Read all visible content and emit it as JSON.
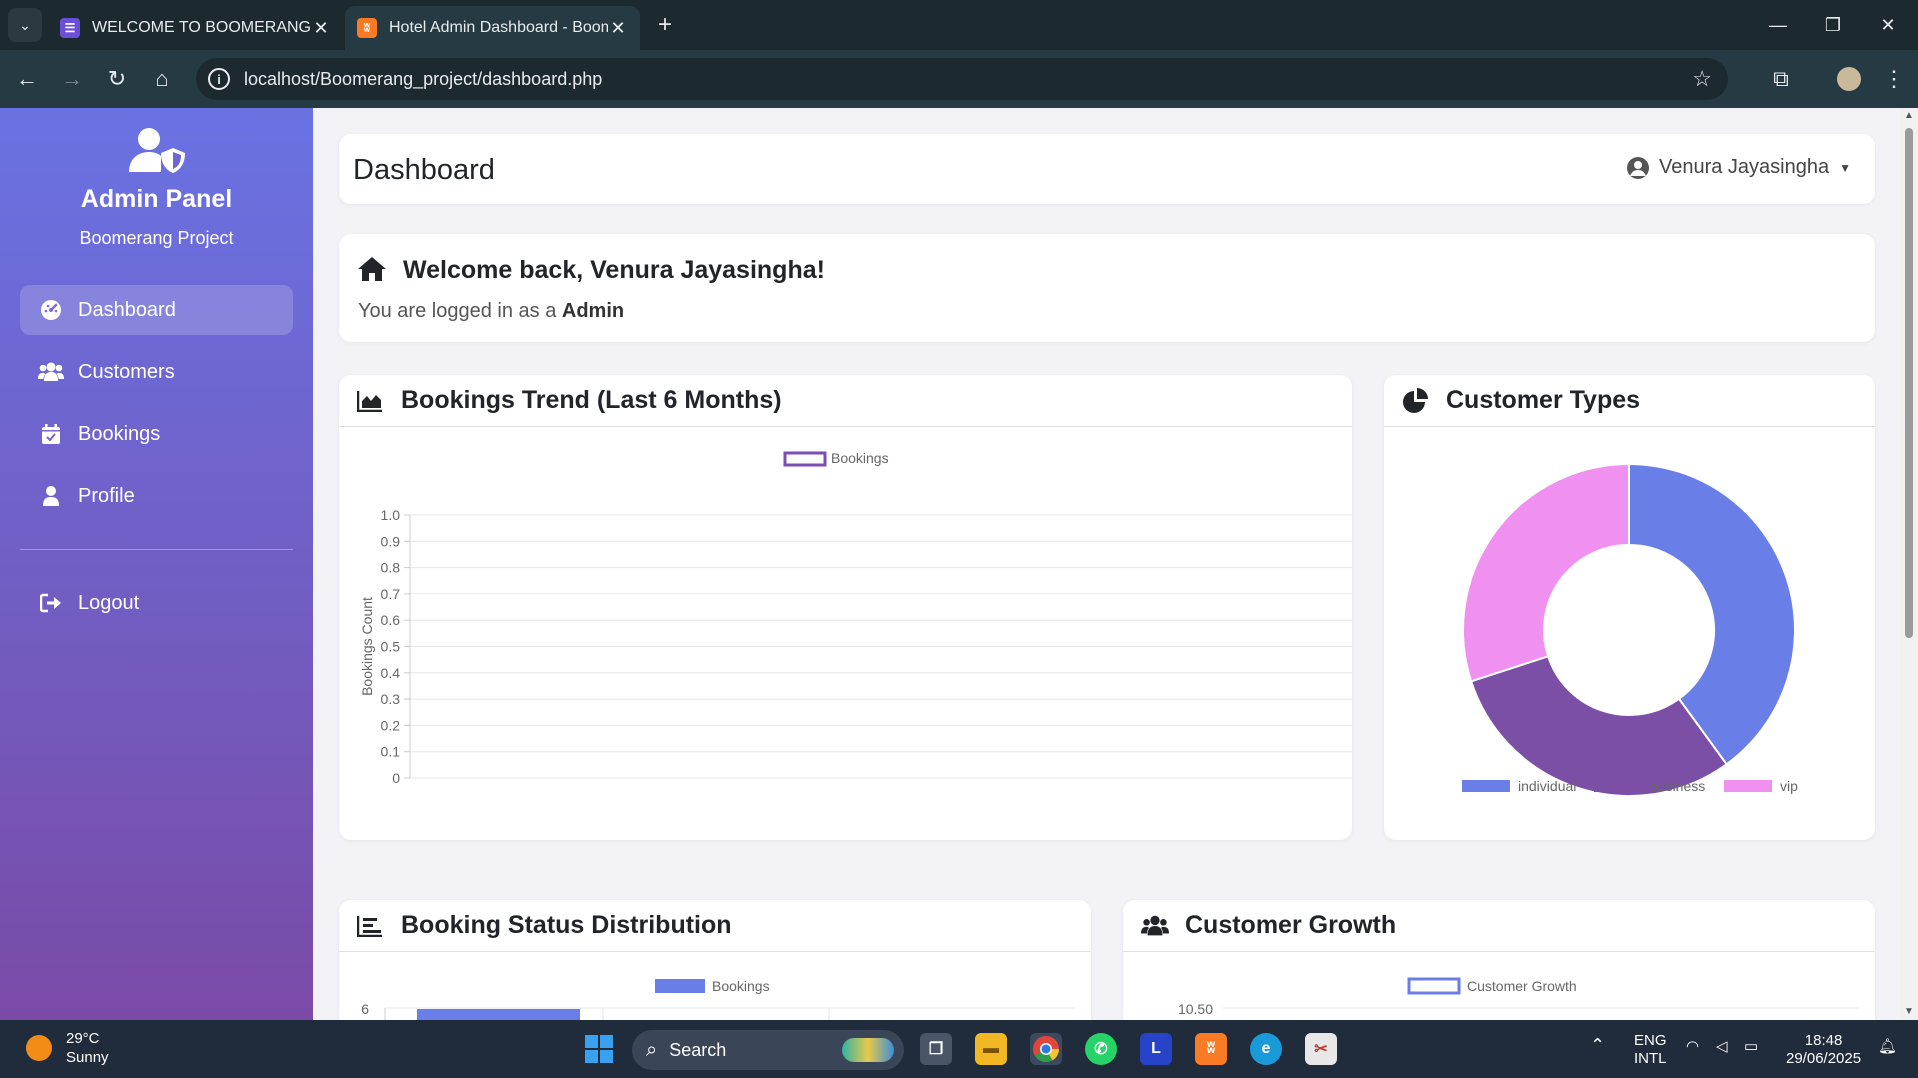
{
  "browser": {
    "tabs": [
      {
        "title": "WELCOME TO BOOMERANG SC",
        "active": false
      },
      {
        "title": "Hotel Admin Dashboard - Boom",
        "active": true
      }
    ],
    "url": "localhost/Boomerang_project/dashboard.php"
  },
  "sidebar": {
    "title": "Admin Panel",
    "subtitle": "Boomerang Project",
    "items": [
      {
        "label": "Dashboard",
        "icon": "dashboard-icon",
        "active": true
      },
      {
        "label": "Customers",
        "icon": "users-icon",
        "active": false
      },
      {
        "label": "Bookings",
        "icon": "calendar-check-icon",
        "active": false
      },
      {
        "label": "Profile",
        "icon": "user-icon",
        "active": false
      }
    ],
    "logout": {
      "label": "Logout",
      "icon": "sign-out-icon"
    }
  },
  "header": {
    "title": "Dashboard",
    "user_name": "Venura Jayasingha"
  },
  "welcome": {
    "heading": "Welcome back, Venura Jayasingha!",
    "text_prefix": "You are logged in as a",
    "role": "Admin"
  },
  "cards": {
    "trend_title": "Bookings Trend (Last 6 Months)",
    "types_title": "Customer Types",
    "status_title": "Booking Status Distribution",
    "growth_title": "Customer Growth"
  },
  "chart_data": [
    {
      "type": "line",
      "title": "Bookings Trend (Last 6 Months)",
      "ylabel": "Bookings Count",
      "ylim": [
        0,
        1.0
      ],
      "yticks": [
        "1.0",
        "0.9",
        "0.8",
        "0.7",
        "0.6",
        "0.5",
        "0.4",
        "0.3",
        "0.2",
        "0.1",
        "0"
      ],
      "series": [
        {
          "name": "Bookings",
          "values": [],
          "color": "#7b4fb1"
        }
      ],
      "legend": "top"
    },
    {
      "type": "pie",
      "title": "Customer Types",
      "categories": [
        "individual",
        "business",
        "vip"
      ],
      "values": [
        40,
        30,
        30
      ],
      "colors": [
        "#6a7ee8",
        "#7b4fa6",
        "#f090f0"
      ],
      "legend": "bottom"
    },
    {
      "type": "bar",
      "title": "Booking Status Distribution",
      "series": [
        {
          "name": "Bookings",
          "color": "#6a7ee8"
        }
      ],
      "yticks": [
        "6"
      ],
      "legend": "top"
    },
    {
      "type": "line",
      "title": "Customer Growth",
      "series": [
        {
          "name": "Customer Growth",
          "color": "#6a7ee8"
        }
      ],
      "yticks": [
        "10.50"
      ],
      "legend": "top"
    }
  ],
  "taskbar": {
    "weather_temp": "29°C",
    "weather_text": "Sunny",
    "search_label": "Search",
    "lang": "ENG",
    "lang_sub": "INTL",
    "time": "18:48",
    "date": "29/06/2025"
  }
}
